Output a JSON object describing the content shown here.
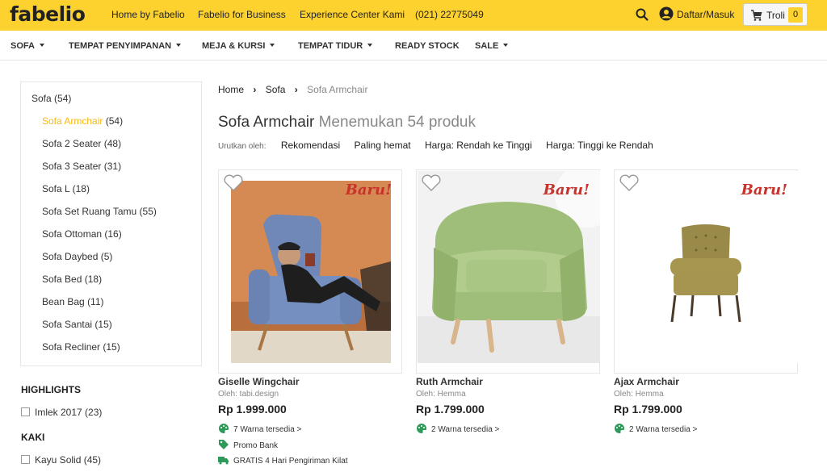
{
  "brand": {
    "logo": "fabelio",
    "accent": "#fdd22f",
    "highlight": "#f5b816"
  },
  "topnav": {
    "links": [
      "Home by Fabelio",
      "Fabelio for Business",
      "Experience Center Kami",
      "(021) 22775049"
    ],
    "login": "Daftar/Masuk",
    "cart_label": "Troli",
    "cart_count": "0"
  },
  "catnav": {
    "items": [
      "SOFA",
      "TEMPAT PENYIMPANAN",
      "MEJA & KURSI",
      "TEMPAT TIDUR",
      "READY STOCK",
      "SALE"
    ]
  },
  "sidebar": {
    "parent": "Sofa (54)",
    "subcategories": [
      {
        "label": "Sofa Armchair",
        "count": "(54)"
      },
      {
        "label": "Sofa 2 Seater",
        "count": "(48)"
      },
      {
        "label": "Sofa 3 Seater",
        "count": "(31)"
      },
      {
        "label": "Sofa L",
        "count": "(18)"
      },
      {
        "label": "Sofa Set Ruang Tamu",
        "count": "(55)"
      },
      {
        "label": "Sofa Ottoman",
        "count": "(16)"
      },
      {
        "label": "Sofa Daybed",
        "count": "(5)"
      },
      {
        "label": "Sofa Bed",
        "count": "(18)"
      },
      {
        "label": "Bean Bag",
        "count": "(11)"
      },
      {
        "label": "Sofa Santai",
        "count": "(15)"
      },
      {
        "label": "Sofa Recliner",
        "count": "(15)"
      }
    ],
    "highlights_heading": "HIGHLIGHTS",
    "highlights": [
      "Imlek 2017 (23)"
    ],
    "kaki_heading": "KAKI",
    "kaki": [
      "Kayu Solid (45)"
    ]
  },
  "breadcrumb": {
    "home": "Home",
    "category": "Sofa",
    "current": "Sofa Armchair"
  },
  "heading": {
    "title": "Sofa Armchair",
    "result_count": "Menemukan 54 produk"
  },
  "sort": {
    "label": "Urutkan oleh:",
    "options": [
      "Rekomendasi",
      "Paling hemat",
      "Harga: Rendah ke Tinggi",
      "Harga: Tinggi ke Rendah"
    ]
  },
  "products": [
    {
      "name": "Giselle Wingchair",
      "by": "Oleh: tabi.design",
      "price": "Rp 1.999.000",
      "badge": "Baru!",
      "colors": "7 Warna tersedia >",
      "promo": "Promo Bank",
      "shipping": "GRATIS 4 Hari Pengiriman Kilat"
    },
    {
      "name": "Ruth Armchair",
      "by": "Oleh: Hemma",
      "price": "Rp 1.799.000",
      "badge": "Baru!",
      "colors": "2 Warna tersedia >"
    },
    {
      "name": "Ajax Armchair",
      "by": "Oleh: Hemma",
      "price": "Rp 1.799.000",
      "badge": "Baru!",
      "colors": "2 Warna tersedia >"
    }
  ]
}
